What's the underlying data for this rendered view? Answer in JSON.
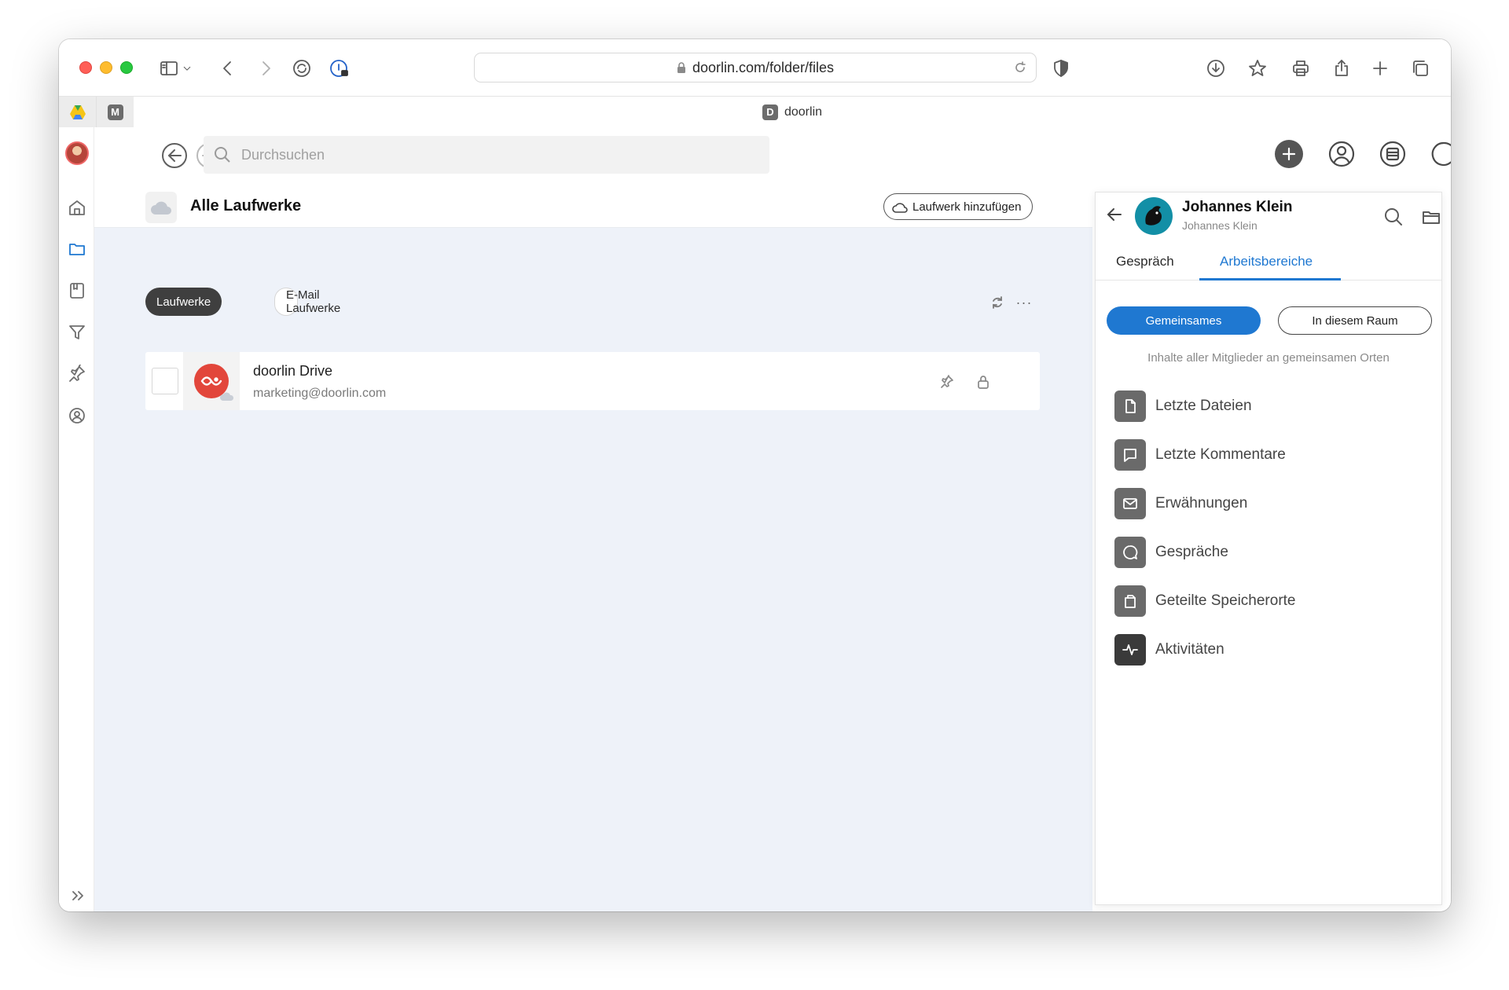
{
  "browser": {
    "url": "doorlin.com/folder/files",
    "active_tab": {
      "favicon_letter": "D",
      "title": "doorlin"
    },
    "pinned_tabs": [
      {
        "name": "drive-pinned-tab",
        "letter": ""
      },
      {
        "name": "m-pinned-tab",
        "letter": "M"
      }
    ]
  },
  "topbar": {
    "search_placeholder": "Durchsuchen"
  },
  "main": {
    "title": "Alle Laufwerke",
    "add_drive_label": "Laufwerk hinzufügen",
    "filters": [
      {
        "label": "Laufwerke",
        "active": true
      },
      {
        "label": "E-Mail Laufwerke",
        "active": false
      }
    ],
    "more_label": "···",
    "drives": [
      {
        "name": "doorlin Drive",
        "email": "marketing@doorlin.com"
      }
    ]
  },
  "panel": {
    "user_name": "Johannes Klein",
    "user_sub": "Johannes Klein",
    "tabs": [
      {
        "label": "Gespräch",
        "active": false
      },
      {
        "label": "Arbeitsbereiche",
        "active": true
      }
    ],
    "segments": [
      {
        "label": "Gemeinsames",
        "active": true
      },
      {
        "label": "In diesem Raum",
        "active": false
      }
    ],
    "hint": "Inhalte aller Mitglieder an gemeinsamen Orten",
    "items": [
      {
        "label": "Letzte Dateien",
        "icon": "file-icon"
      },
      {
        "label": "Letzte Kommentare",
        "icon": "comment-icon"
      },
      {
        "label": "Erwähnungen",
        "icon": "mail-icon"
      },
      {
        "label": "Gespräche",
        "icon": "chat-icon"
      },
      {
        "label": "Geteilte Speicherorte",
        "icon": "shared-folder-icon"
      },
      {
        "label": "Aktivitäten",
        "icon": "activity-icon"
      }
    ]
  },
  "colors": {
    "accent": "#1f78d1",
    "main_bg": "#eef2f9",
    "drive_logo": "#e2463b",
    "avatar_bg": "#138fa6"
  }
}
